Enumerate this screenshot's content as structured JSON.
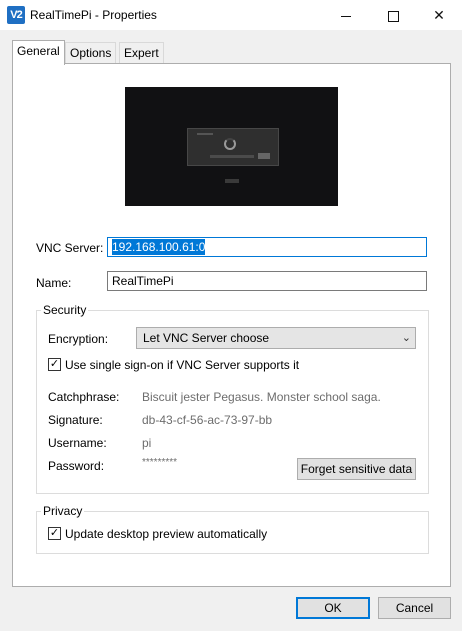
{
  "window": {
    "app_icon": "V2",
    "title": "RealTimePi - Properties",
    "minimize_icon": "minimize-icon",
    "maximize_icon": "maximize-icon",
    "close_glyph": "✕"
  },
  "tabs": [
    {
      "label": "General",
      "active": true
    },
    {
      "label": "Options",
      "active": false
    },
    {
      "label": "Expert",
      "active": false
    }
  ],
  "general": {
    "vnc_server_label": "VNC Server:",
    "vnc_server_value": "192.168.100.61:0",
    "name_label": "Name:",
    "name_value": "RealTimePi"
  },
  "security": {
    "legend": "Security",
    "encryption_label": "Encryption:",
    "encryption_value": "Let VNC Server choose",
    "sso_label": "Use single sign-on if VNC Server supports it",
    "sso_checked": true,
    "catchphrase_label": "Catchphrase:",
    "catchphrase_value": "Biscuit jester Pegasus. Monster school saga.",
    "signature_label": "Signature:",
    "signature_value": "db-43-cf-56-ac-73-97-bb",
    "username_label": "Username:",
    "username_value": "pi",
    "password_label": "Password:",
    "password_value": "*********",
    "forget_button": "Forget sensitive data"
  },
  "privacy": {
    "legend": "Privacy",
    "update_preview_label": "Update desktop preview automatically",
    "update_preview_checked": true
  },
  "footer": {
    "ok_label": "OK",
    "cancel_label": "Cancel"
  },
  "colors": {
    "accent": "#0078d7",
    "window_bg": "#f0f0f0",
    "panel_bg": "#ffffff",
    "app_icon_bg": "#1f6fc3"
  }
}
